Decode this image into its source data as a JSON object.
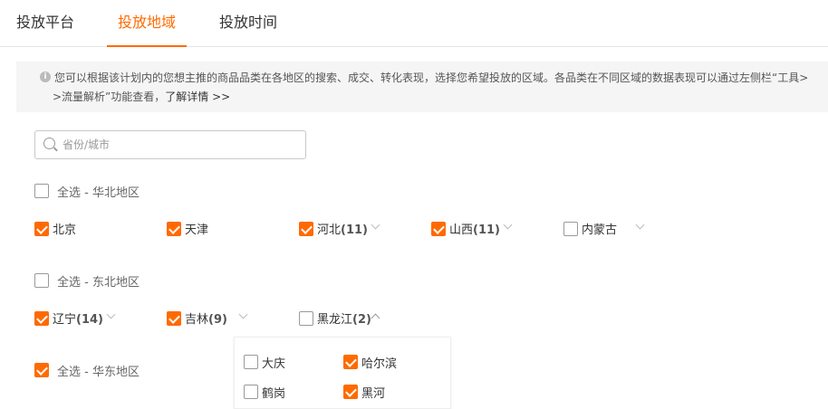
{
  "tabs": [
    {
      "label": "投放平台",
      "active": false
    },
    {
      "label": "投放地域",
      "active": true
    },
    {
      "label": "投放时间",
      "active": false
    }
  ],
  "notice": {
    "icon": "info-icon",
    "line1": "您可以根据该计划内的您想主推的商品品类在各地区的搜索、成交、转化表现，选择您希望投放的区域。各品类在不同区域的数据表现可以通过左侧栏“工具>",
    "line2_prefix": ">流量解析”功能查看，",
    "link": "了解详情 >>"
  },
  "search": {
    "placeholder": "省份/城市",
    "value": ""
  },
  "regions": [
    {
      "select_all_label": "全选 - 华北地区",
      "checked": false,
      "provinces": [
        {
          "name": "北京",
          "count": "",
          "checked": true,
          "expandable": false
        },
        {
          "name": "天津",
          "count": "",
          "checked": true,
          "expandable": false
        },
        {
          "name": "河北",
          "count": "(11)",
          "checked": true,
          "expandable": true
        },
        {
          "name": "山西",
          "count": "(11)",
          "checked": true,
          "expandable": true
        },
        {
          "name": "内蒙古",
          "count": "",
          "checked": false,
          "expandable": true
        }
      ]
    },
    {
      "select_all_label": "全选 - 东北地区",
      "checked": false,
      "provinces": [
        {
          "name": "辽宁",
          "count": "(14)",
          "checked": true,
          "expandable": true
        },
        {
          "name": "吉林",
          "count": "(9)",
          "checked": true,
          "expandable": true
        },
        {
          "name": "黑龙江",
          "count": "(2)",
          "checked": false,
          "expandable": true,
          "expanded": true
        }
      ]
    },
    {
      "select_all_label": "全选 - 华东地区",
      "checked": true,
      "provinces": []
    }
  ],
  "dropdown": {
    "cities": [
      {
        "name": "大庆",
        "checked": false
      },
      {
        "name": "哈尔滨",
        "checked": true
      },
      {
        "name": "鹤岗",
        "checked": false
      },
      {
        "name": "黑河",
        "checked": true
      }
    ]
  },
  "colors": {
    "accent": "#ff6a00"
  }
}
